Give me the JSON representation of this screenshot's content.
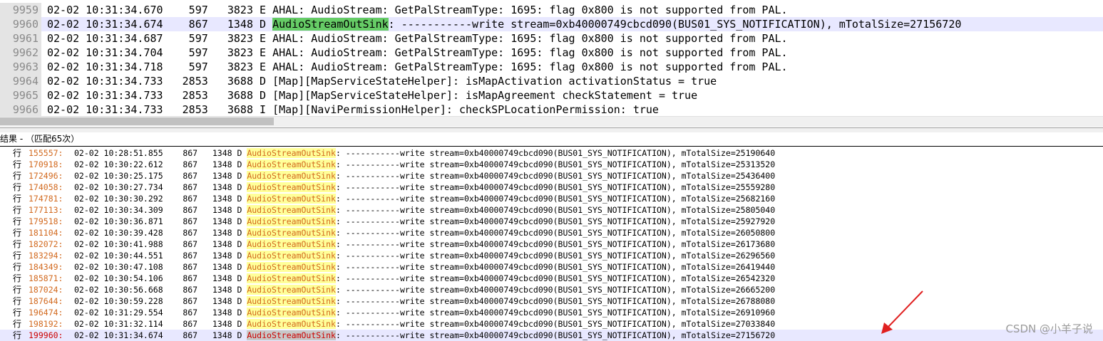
{
  "editor": {
    "lines": [
      {
        "num": "9959",
        "timestamp": "02-02 10:31:34.670",
        "pid": "597",
        "tid": "3823",
        "level": "E",
        "tag": "AHAL: AudioStream",
        "message": ": GetPalStreamType: 1695: flag 0x800 is not supported from PAL.",
        "current": false
      },
      {
        "num": "9960",
        "timestamp": "02-02 10:31:34.674",
        "pid": "867",
        "tid": "1348",
        "level": "D",
        "tag": "AudioStreamOutSink",
        "message": ": -----------write stream=0xb40000749cbcd090(BUS01_SYS_NOTIFICATION), mTotalSize=27156720",
        "current": true
      },
      {
        "num": "9961",
        "timestamp": "02-02 10:31:34.687",
        "pid": "597",
        "tid": "3823",
        "level": "E",
        "tag": "AHAL: AudioStream",
        "message": ": GetPalStreamType: 1695: flag 0x800 is not supported from PAL.",
        "current": false
      },
      {
        "num": "9962",
        "timestamp": "02-02 10:31:34.704",
        "pid": "597",
        "tid": "3823",
        "level": "E",
        "tag": "AHAL: AudioStream",
        "message": ": GetPalStreamType: 1695: flag 0x800 is not supported from PAL.",
        "current": false
      },
      {
        "num": "9963",
        "timestamp": "02-02 10:31:34.718",
        "pid": "597",
        "tid": "3823",
        "level": "E",
        "tag": "AHAL: AudioStream",
        "message": ": GetPalStreamType: 1695: flag 0x800 is not supported from PAL.",
        "current": false
      },
      {
        "num": "9964",
        "timestamp": "02-02 10:31:34.733",
        "pid": "2853",
        "tid": "3688",
        "level": "D",
        "tag": "[Map][MapServiceStateHelper]",
        "message": ": isMapActivation activationStatus = true",
        "current": false
      },
      {
        "num": "9965",
        "timestamp": "02-02 10:31:34.733",
        "pid": "2853",
        "tid": "3688",
        "level": "D",
        "tag": "[Map][MapServiceStateHelper]",
        "message": ": isMapAgreement checkStatement = true",
        "current": false
      },
      {
        "num": "9966",
        "timestamp": "02-02 10:31:34.733",
        "pid": "2853",
        "tid": "3688",
        "level": "I",
        "tag": "[Map][NaviPermissionHelper]",
        "message": ": checkSPLocationPermission: true",
        "current": false
      }
    ],
    "highlight_term": "AudioStreamOutSink"
  },
  "results": {
    "header": "结果 - （匹配65次）",
    "line_prefix": "行",
    "match_tag": "AudioStreamOutSink",
    "rows": [
      {
        "line": "155557",
        "timestamp": "02-02 10:28:51.855",
        "pid": "867",
        "tid": "1348",
        "level": "D",
        "rest": ": -----------write stream=0xb40000749cbcd090(BUS01_SYS_NOTIFICATION), mTotalSize=25190640"
      },
      {
        "line": "170918",
        "timestamp": "02-02 10:30:22.612",
        "pid": "867",
        "tid": "1348",
        "level": "D",
        "rest": ": -----------write stream=0xb40000749cbcd090(BUS01_SYS_NOTIFICATION), mTotalSize=25313520"
      },
      {
        "line": "172496",
        "timestamp": "02-02 10:30:25.175",
        "pid": "867",
        "tid": "1348",
        "level": "D",
        "rest": ": -----------write stream=0xb40000749cbcd090(BUS01_SYS_NOTIFICATION), mTotalSize=25436400"
      },
      {
        "line": "174058",
        "timestamp": "02-02 10:30:27.734",
        "pid": "867",
        "tid": "1348",
        "level": "D",
        "rest": ": -----------write stream=0xb40000749cbcd090(BUS01_SYS_NOTIFICATION), mTotalSize=25559280"
      },
      {
        "line": "174781",
        "timestamp": "02-02 10:30:30.292",
        "pid": "867",
        "tid": "1348",
        "level": "D",
        "rest": ": -----------write stream=0xb40000749cbcd090(BUS01_SYS_NOTIFICATION), mTotalSize=25682160"
      },
      {
        "line": "177113",
        "timestamp": "02-02 10:30:34.309",
        "pid": "867",
        "tid": "1348",
        "level": "D",
        "rest": ": -----------write stream=0xb40000749cbcd090(BUS01_SYS_NOTIFICATION), mTotalSize=25805040"
      },
      {
        "line": "179518",
        "timestamp": "02-02 10:30:36.871",
        "pid": "867",
        "tid": "1348",
        "level": "D",
        "rest": ": -----------write stream=0xb40000749cbcd090(BUS01_SYS_NOTIFICATION), mTotalSize=25927920"
      },
      {
        "line": "181104",
        "timestamp": "02-02 10:30:39.428",
        "pid": "867",
        "tid": "1348",
        "level": "D",
        "rest": ": -----------write stream=0xb40000749cbcd090(BUS01_SYS_NOTIFICATION), mTotalSize=26050800"
      },
      {
        "line": "182072",
        "timestamp": "02-02 10:30:41.988",
        "pid": "867",
        "tid": "1348",
        "level": "D",
        "rest": ": -----------write stream=0xb40000749cbcd090(BUS01_SYS_NOTIFICATION), mTotalSize=26173680"
      },
      {
        "line": "183294",
        "timestamp": "02-02 10:30:44.551",
        "pid": "867",
        "tid": "1348",
        "level": "D",
        "rest": ": -----------write stream=0xb40000749cbcd090(BUS01_SYS_NOTIFICATION), mTotalSize=26296560"
      },
      {
        "line": "184349",
        "timestamp": "02-02 10:30:47.108",
        "pid": "867",
        "tid": "1348",
        "level": "D",
        "rest": ": -----------write stream=0xb40000749cbcd090(BUS01_SYS_NOTIFICATION), mTotalSize=26419440"
      },
      {
        "line": "185871",
        "timestamp": "02-02 10:30:54.106",
        "pid": "867",
        "tid": "1348",
        "level": "D",
        "rest": ": -----------write stream=0xb40000749cbcd090(BUS01_SYS_NOTIFICATION), mTotalSize=26542320"
      },
      {
        "line": "187024",
        "timestamp": "02-02 10:30:56.668",
        "pid": "867",
        "tid": "1348",
        "level": "D",
        "rest": ": -----------write stream=0xb40000749cbcd090(BUS01_SYS_NOTIFICATION), mTotalSize=26665200"
      },
      {
        "line": "187644",
        "timestamp": "02-02 10:30:59.228",
        "pid": "867",
        "tid": "1348",
        "level": "D",
        "rest": ": -----------write stream=0xb40000749cbcd090(BUS01_SYS_NOTIFICATION), mTotalSize=26788080"
      },
      {
        "line": "196474",
        "timestamp": "02-02 10:31:29.554",
        "pid": "867",
        "tid": "1348",
        "level": "D",
        "rest": ": -----------write stream=0xb40000749cbcd090(BUS01_SYS_NOTIFICATION), mTotalSize=26910960"
      },
      {
        "line": "198192",
        "timestamp": "02-02 10:31:32.114",
        "pid": "867",
        "tid": "1348",
        "level": "D",
        "rest": ": -----------write stream=0xb40000749cbcd090(BUS01_SYS_NOTIFICATION), mTotalSize=27033840"
      },
      {
        "line": "199960",
        "timestamp": "02-02 10:31:34.674",
        "pid": "867",
        "tid": "1348",
        "level": "D",
        "rest": ": -----------write stream=0xb40000749cbcd090(BUS01_SYS_NOTIFICATION), mTotalSize=27156720"
      }
    ]
  },
  "watermark": "CSDN @小羊子说",
  "colors": {
    "editor_match_highlight": "#66cc66",
    "result_match_highlight": "#ffff99",
    "line_number_color": "#d2691e",
    "annotation_arrow": "#e02020"
  },
  "annotation": {
    "arrow_icon": "red-arrow-icon"
  }
}
